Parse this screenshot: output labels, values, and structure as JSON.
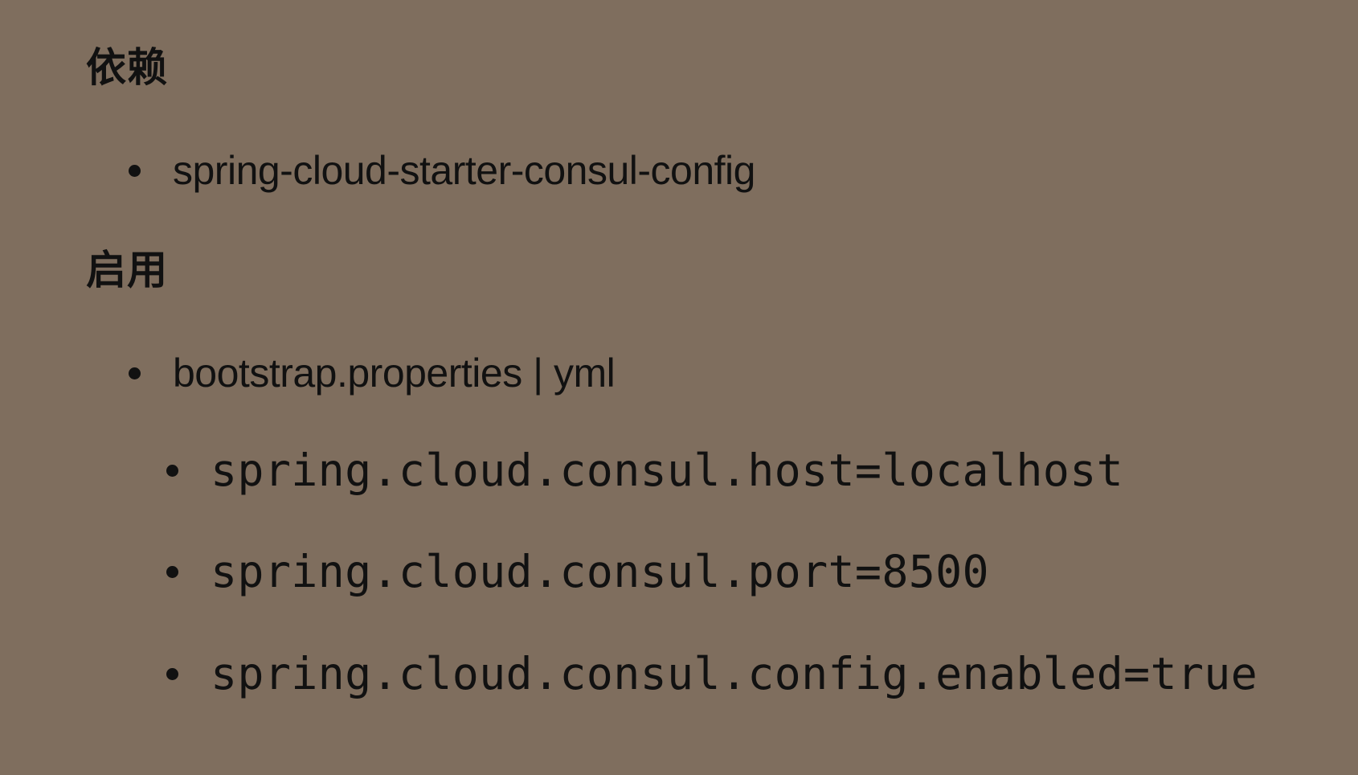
{
  "sections": [
    {
      "heading": "依赖",
      "items": [
        "spring-cloud-starter-consul-config"
      ]
    },
    {
      "heading": "启用",
      "items": [
        "bootstrap.properties | yml"
      ],
      "subitems": [
        "spring.cloud.consul.host=localhost",
        "spring.cloud.consul.port=8500",
        "spring.cloud.consul.config.enabled=true"
      ]
    }
  ],
  "colors": {
    "background": "#7f6e5e",
    "text": "#111111"
  }
}
